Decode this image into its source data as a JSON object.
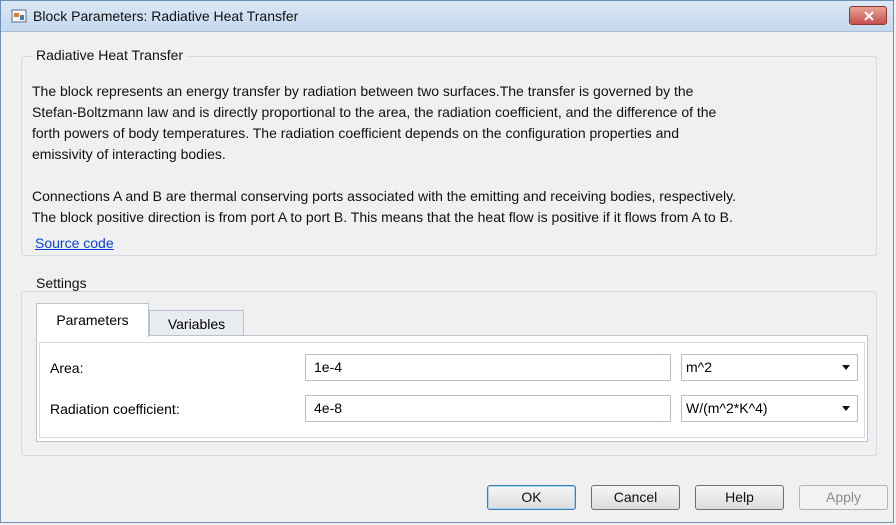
{
  "window": {
    "title": "Block Parameters: Radiative Heat Transfer"
  },
  "description": {
    "group_title": "Radiative Heat Transfer",
    "paragraph1_lines": [
      "The block represents an energy transfer by radiation between two surfaces.The transfer is governed by the",
      "Stefan-Boltzmann law and is directly proportional to the area, the radiation coefficient, and the difference of the",
      "forth powers of body temperatures. The radiation coefficient depends on the configuration properties and",
      "emissivity of interacting bodies."
    ],
    "paragraph2_lines": [
      "Connections A and B are thermal conserving ports associated with the emitting and receiving bodies, respectively.",
      "The block positive direction is from port A to port B. This means that the heat flow is positive if it flows from A to B."
    ],
    "source_link": "Source code"
  },
  "settings": {
    "group_title": "Settings",
    "tabs": [
      {
        "label": "Parameters",
        "active": true
      },
      {
        "label": "Variables",
        "active": false
      }
    ],
    "params": [
      {
        "label": "Area:",
        "value": "1e-4",
        "unit": "m^2"
      },
      {
        "label": "Radiation coefficient:",
        "value": "4e-8",
        "unit": "W/(m^2*K^4)"
      }
    ]
  },
  "buttons": {
    "ok": "OK",
    "cancel": "Cancel",
    "help": "Help",
    "apply": "Apply"
  },
  "colors": {
    "link": "#0645d1",
    "close_button": "#c75050",
    "titlebar": "#c6d8ee"
  },
  "icons": {
    "app": "simulink-block-icon",
    "close": "close-icon",
    "dropdown": "chevron-down-icon"
  }
}
